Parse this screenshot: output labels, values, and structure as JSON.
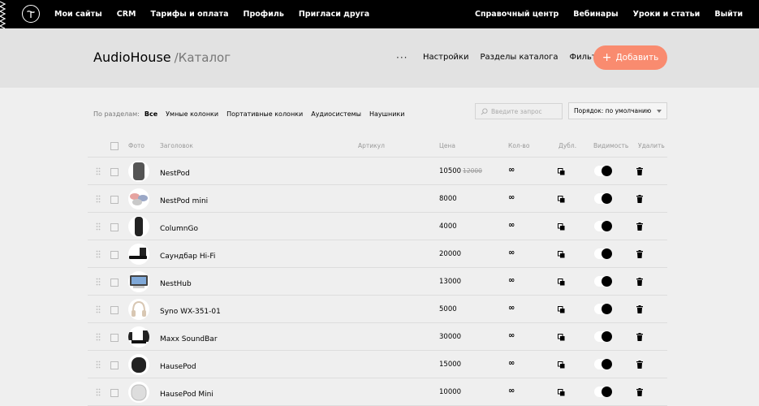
{
  "nav": {
    "left": [
      "Мои сайты",
      "CRM",
      "Тарифы и оплата",
      "Профиль",
      "Пригласи друга"
    ],
    "right": [
      "Справочный центр",
      "Вебинары",
      "Уроки и статьи",
      "Выйти"
    ]
  },
  "header": {
    "title": "AudioHouse",
    "subtitle": "/Каталог",
    "more": "···",
    "links": [
      "Настройки",
      "Разделы каталога",
      "Фильтры"
    ],
    "add_button": "Добавить",
    "accent": "#f98b6f"
  },
  "filters": {
    "label": "По разделам:",
    "items": [
      "Все",
      "Умные колонки",
      "Портативные колонки",
      "Аудиосистемы",
      "Наушники"
    ],
    "active": 0
  },
  "search": {
    "placeholder": "Введите запрос",
    "icon": "search-icon"
  },
  "sort": {
    "value": "Порядок: по умолчанию"
  },
  "columns": {
    "photo": "Фото",
    "title": "Заголовок",
    "sku": "Артикул",
    "price": "Цена",
    "qty": "Кол-во",
    "dup": "Дубл.",
    "vis": "Видимость",
    "del": "Удалить"
  },
  "products": [
    {
      "name": "NestPod",
      "price": "10500",
      "old_price": "12000",
      "qty": "∞",
      "photo": "smart-speaker-gray"
    },
    {
      "name": "NestPod mini",
      "price": "8000",
      "old_price": "",
      "qty": "∞",
      "photo": "mini-speakers-colored"
    },
    {
      "name": "ColumnGo",
      "price": "4000",
      "old_price": "",
      "qty": "∞",
      "photo": "column-speaker-black"
    },
    {
      "name": "Саундбар Hi-Fi",
      "price": "20000",
      "old_price": "",
      "qty": "∞",
      "photo": "soundbar-black"
    },
    {
      "name": "NestHub",
      "price": "13000",
      "old_price": "",
      "qty": "∞",
      "photo": "smart-display"
    },
    {
      "name": "Syno WX-351-01",
      "price": "5000",
      "old_price": "",
      "qty": "∞",
      "photo": "headphones-beige"
    },
    {
      "name": "Maxx SoundBar",
      "price": "30000",
      "old_price": "",
      "qty": "∞",
      "photo": "soundbar-set"
    },
    {
      "name": "HausePod",
      "price": "15000",
      "old_price": "",
      "qty": "∞",
      "photo": "round-speaker-black"
    },
    {
      "name": "HausePod Mini",
      "price": "10000",
      "old_price": "",
      "qty": "∞",
      "photo": "round-speaker-white"
    }
  ]
}
